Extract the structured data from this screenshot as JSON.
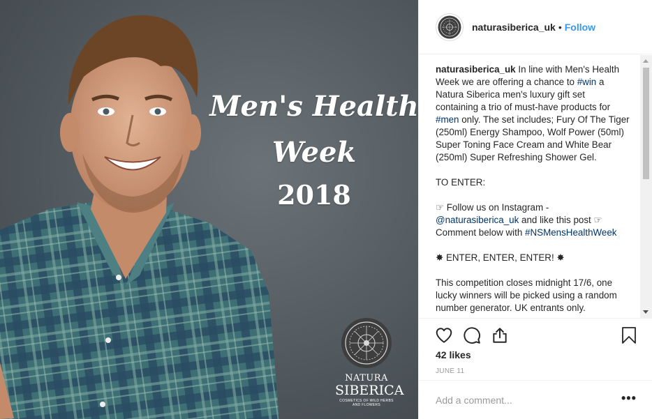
{
  "post_image": {
    "headline_line1": "Men's Health",
    "headline_line2": "Week",
    "headline_line3": "2018",
    "brand_line1": "NATURA",
    "brand_line2": "SIBERICA",
    "brand_tagline": "COSMETICS OF WILD HERBS AND FLOWERS"
  },
  "header": {
    "username": "naturasiberica_uk",
    "separator": "•",
    "follow_label": "Follow"
  },
  "caption": {
    "username": "naturasiberica_uk",
    "p1_a": " In line with Men's Health Week we are offering a chance to ",
    "p1_tag_win": "#win",
    "p1_b": " a Natura Siberica men's luxury gift set containing a trio of must-have products for ",
    "p1_tag_men": "#men",
    "p1_c": " only. The set includes; Fury Of The Tiger (250ml) Energy Shampoo, Wolf Power (50ml) Super Toning Face Cream and White Bear (250ml) Super Refreshing Shower Gel.",
    "to_enter": "TO ENTER:",
    "step_a": "☞ Follow us on Instagram - ",
    "step_mention": "@naturasiberica_uk",
    "step_b": " and like this post ☞ Comment below with ",
    "step_hashtag": "#NSMensHealthWeek",
    "enter_line": "✸ ENTER, ENTER, ENTER! ✸",
    "closing": "This competition closes midnight 17/6, one lucky winners will be picked using a random number generator. UK entrants only."
  },
  "icons": {
    "like": "heart-icon",
    "comment": "comment-icon",
    "share": "share-icon",
    "save": "bookmark-icon"
  },
  "likes": "42 likes",
  "date": "JUNE 11",
  "comment": {
    "placeholder": "Add a comment...",
    "more_label": "•••"
  },
  "colors": {
    "link": "#3897f0",
    "hashtag": "#003569",
    "border": "#efefef"
  }
}
